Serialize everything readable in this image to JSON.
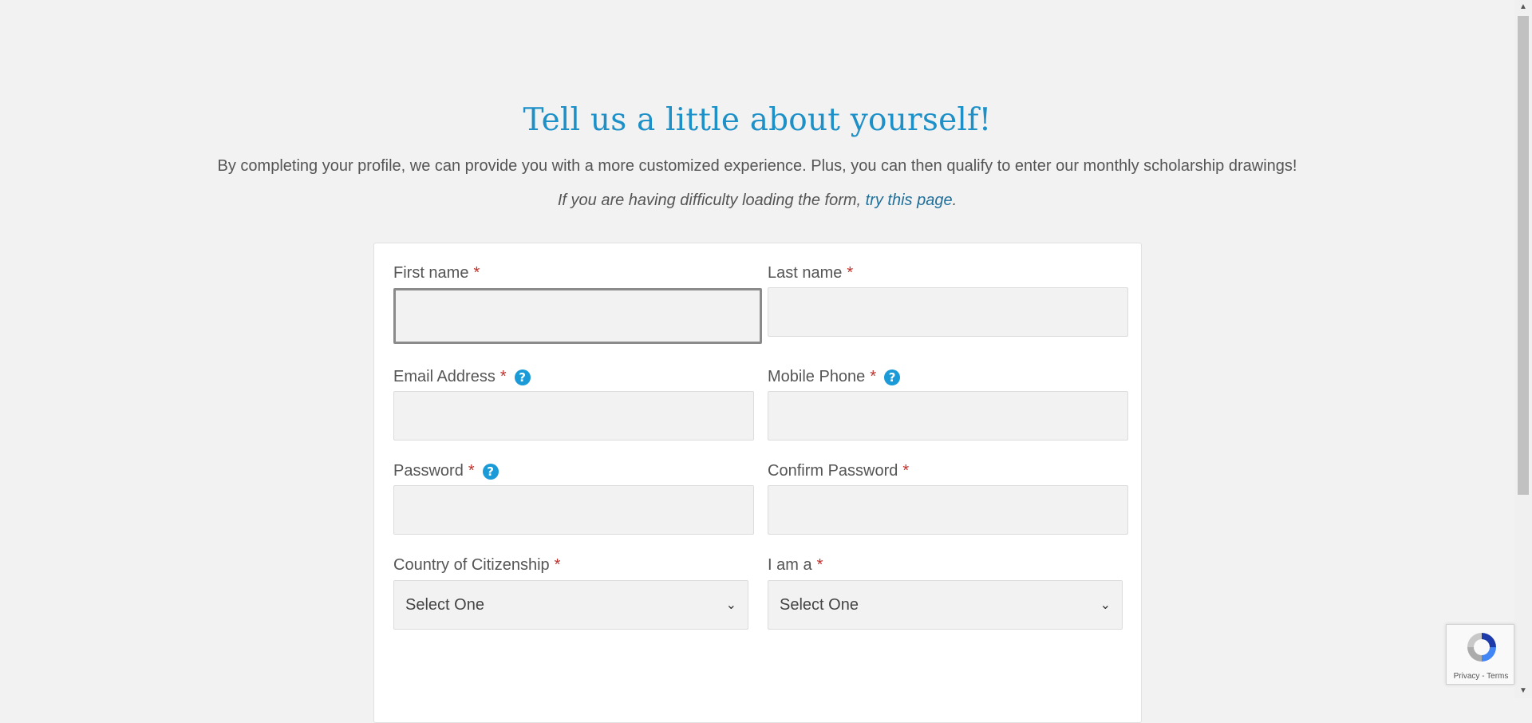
{
  "header": {
    "title": "Tell us a little about yourself!",
    "intro": "By completing your profile, we can provide you with a more customized experience. Plus, you can then qualify to enter our monthly scholarship drawings!",
    "note_prefix": "If you are having difficulty loading the form, ",
    "note_link": "try this page",
    "note_suffix": "."
  },
  "form": {
    "required_mark": "*",
    "help_glyph": "?",
    "first_name": {
      "label": "First name",
      "value": ""
    },
    "last_name": {
      "label": "Last name",
      "value": ""
    },
    "email": {
      "label": "Email Address",
      "value": ""
    },
    "mobile_phone": {
      "label": "Mobile Phone",
      "value": ""
    },
    "password": {
      "label": "Password",
      "value": ""
    },
    "confirm_password": {
      "label": "Confirm Password",
      "value": ""
    },
    "country": {
      "label": "Country of Citizenship",
      "selected": "Select One"
    },
    "i_am_a": {
      "label": "I am a",
      "selected": "Select One"
    }
  },
  "recaptcha": {
    "privacy": "Privacy",
    "separator": " - ",
    "terms": "Terms"
  },
  "icons": {
    "help": "help-circle-icon",
    "chevron": "chevron-down-icon",
    "recaptcha": "recaptcha-logo-icon"
  },
  "colors": {
    "accent": "#1e90c8",
    "link": "#1f6f9a",
    "required": "#c0312b",
    "help_icon": "#1a9ad6",
    "background": "#f2f2f2"
  }
}
